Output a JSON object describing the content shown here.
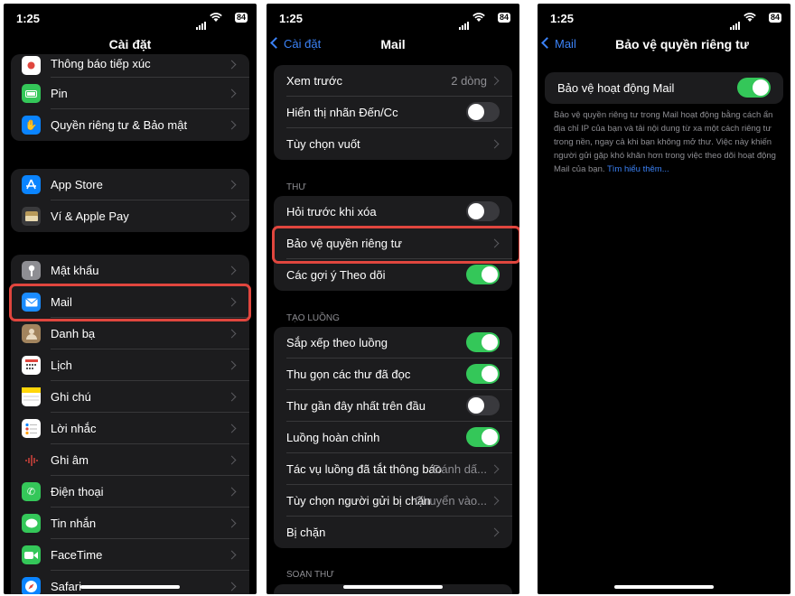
{
  "status": {
    "time": "1:25",
    "battery": "84"
  },
  "screen1": {
    "title": "Cài đặt",
    "group1": [
      {
        "label": "Thông báo tiếp xúc",
        "icon": "exposure-notification-icon",
        "color": "#ffffff"
      },
      {
        "label": "Pin",
        "icon": "battery-icon",
        "color": "#34c759"
      },
      {
        "label": "Quyền riêng tư & Bảo mật",
        "icon": "hand-icon",
        "color": "#0a84ff"
      }
    ],
    "group2": [
      {
        "label": "App Store",
        "icon": "app-store-icon",
        "color": "#0a84ff"
      },
      {
        "label": "Ví & Apple Pay",
        "icon": "wallet-icon",
        "color": "#3a3a3c"
      }
    ],
    "group3": [
      {
        "label": "Mật khẩu",
        "icon": "key-icon",
        "color": "#8e8e93"
      },
      {
        "label": "Mail",
        "icon": "mail-icon",
        "color": "#1a8cff"
      },
      {
        "label": "Danh bạ",
        "icon": "contacts-icon",
        "color": "#a2845e"
      },
      {
        "label": "Lịch",
        "icon": "calendar-icon",
        "color": "#ffffff"
      },
      {
        "label": "Ghi chú",
        "icon": "notes-icon",
        "color": "#ffd60a"
      },
      {
        "label": "Lời nhắc",
        "icon": "reminders-icon",
        "color": "#ffffff"
      },
      {
        "label": "Ghi âm",
        "icon": "voice-memos-icon",
        "color": "#1c1c1e"
      },
      {
        "label": "Điện thoại",
        "icon": "phone-icon",
        "color": "#34c759"
      },
      {
        "label": "Tin nhắn",
        "icon": "messages-icon",
        "color": "#34c759"
      },
      {
        "label": "FaceTime",
        "icon": "facetime-icon",
        "color": "#34c759"
      },
      {
        "label": "Safari",
        "icon": "safari-icon",
        "color": "#0a84ff"
      }
    ]
  },
  "screen2": {
    "back": "Cài đặt",
    "title": "Mail",
    "group1": [
      {
        "label": "Xem trước",
        "value": "2 dòng",
        "type": "nav"
      },
      {
        "label": "Hiển thị nhãn Đến/Cc",
        "type": "toggle",
        "on": false
      },
      {
        "label": "Tùy chọn vuốt",
        "type": "nav"
      }
    ],
    "section_thu": "THƯ",
    "group2": [
      {
        "label": "Hỏi trước khi xóa",
        "type": "toggle",
        "on": false
      },
      {
        "label": "Bảo vệ quyền riêng tư",
        "type": "nav"
      },
      {
        "label": "Các gợi ý Theo dõi",
        "type": "toggle",
        "on": true
      }
    ],
    "section_luong": "TẠO LUỒNG",
    "group3": [
      {
        "label": "Sắp xếp theo luồng",
        "type": "toggle",
        "on": true
      },
      {
        "label": "Thu gọn các thư đã đọc",
        "type": "toggle",
        "on": true
      },
      {
        "label": "Thư gần đây nhất trên đầu",
        "type": "toggle",
        "on": false
      },
      {
        "label": "Luồng hoàn chỉnh",
        "type": "toggle",
        "on": true
      },
      {
        "label": "Tác vụ luồng đã tắt thông báo",
        "value": "Đánh dấ...",
        "type": "nav"
      },
      {
        "label": "Tùy chọn người gửi bị chặn",
        "value": "Chuyển vào...",
        "type": "nav"
      },
      {
        "label": "Bị chặn",
        "type": "nav"
      }
    ],
    "section_soan": "SOẠN THƯ"
  },
  "screen3": {
    "back": "Mail",
    "title": "Bảo vệ quyền riêng tư",
    "toggle_label": "Bảo vệ hoạt động Mail",
    "toggle_on": true,
    "description": "Bảo vệ quyền riêng tư trong Mail hoạt động bằng cách ẩn địa chỉ IP của bạn và tải nội dung từ xa một cách riêng tư trong nền, ngay cả khi bạn không mở thư. Việc này khiến người gửi gặp khó khăn hơn trong việc theo dõi hoạt động Mail của bạn.",
    "learn_more": "Tìm hiểu thêm..."
  }
}
